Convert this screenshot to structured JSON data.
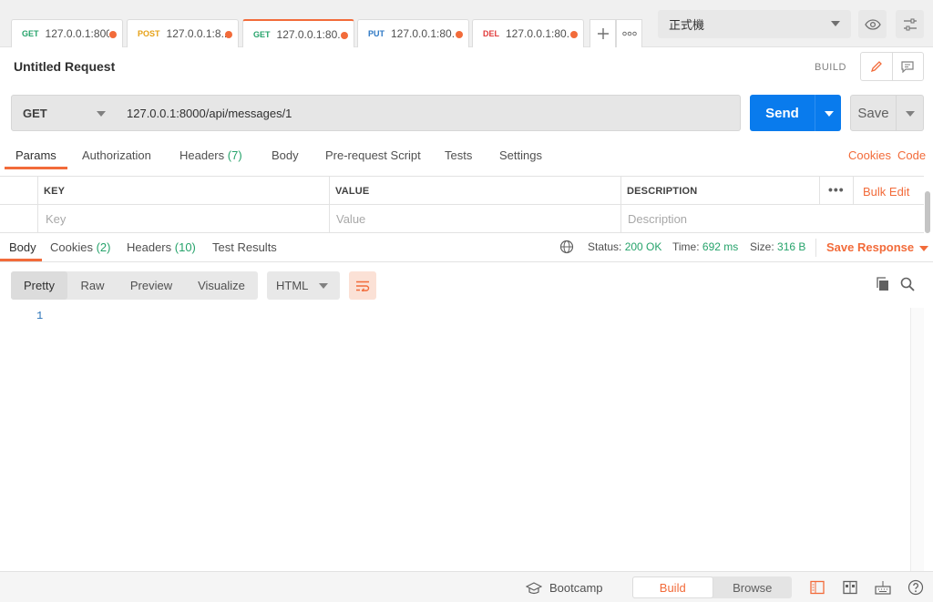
{
  "tabs": [
    {
      "method": "GET",
      "method_color": "#26a36b",
      "url": "127.0.0.1:800"
    },
    {
      "method": "POST",
      "method_color": "#e6a117",
      "url": "127.0.0.1:8..."
    },
    {
      "method": "GET",
      "method_color": "#26a36b",
      "url": "127.0.0.1:80..."
    },
    {
      "method": "PUT",
      "method_color": "#2d78c4",
      "url": "127.0.0.1:80..."
    },
    {
      "method": "DEL",
      "method_color": "#e23c3c",
      "url": "127.0.0.1:80..."
    }
  ],
  "environment": "正式機",
  "request": {
    "title": "Untitled Request",
    "mode_label": "BUILD",
    "method": "GET",
    "url": "127.0.0.1:8000/api/messages/1",
    "send_label": "Send",
    "save_label": "Save"
  },
  "request_tabs": {
    "params": "Params",
    "authorization": "Authorization",
    "headers": "Headers",
    "headers_count": "(7)",
    "body": "Body",
    "prerequest": "Pre-request Script",
    "tests": "Tests",
    "settings": "Settings",
    "cookies": "Cookies",
    "code": "Code"
  },
  "params_table": {
    "columns": [
      "KEY",
      "VALUE",
      "DESCRIPTION"
    ],
    "placeholders": [
      "Key",
      "Value",
      "Description"
    ],
    "more": "•••",
    "bulk_edit": "Bulk Edit"
  },
  "response_tabs": {
    "body": "Body",
    "cookies": "Cookies",
    "cookies_count": "(2)",
    "headers": "Headers",
    "headers_count": "(10)",
    "test_results": "Test Results"
  },
  "response_meta": {
    "status_label": "Status:",
    "status_value": "200 OK",
    "time_label": "Time:",
    "time_value": "692 ms",
    "size_label": "Size:",
    "size_value": "316 B",
    "save_response": "Save Response"
  },
  "response_view": {
    "modes": [
      "Pretty",
      "Raw",
      "Preview",
      "Visualize"
    ],
    "format": "HTML",
    "line_number": "1"
  },
  "footer": {
    "bootcamp": "Bootcamp",
    "build": "Build",
    "browse": "Browse"
  },
  "colors": {
    "accent": "#f26b3a",
    "send_blue": "#097bed",
    "success_green": "#26a36b"
  }
}
